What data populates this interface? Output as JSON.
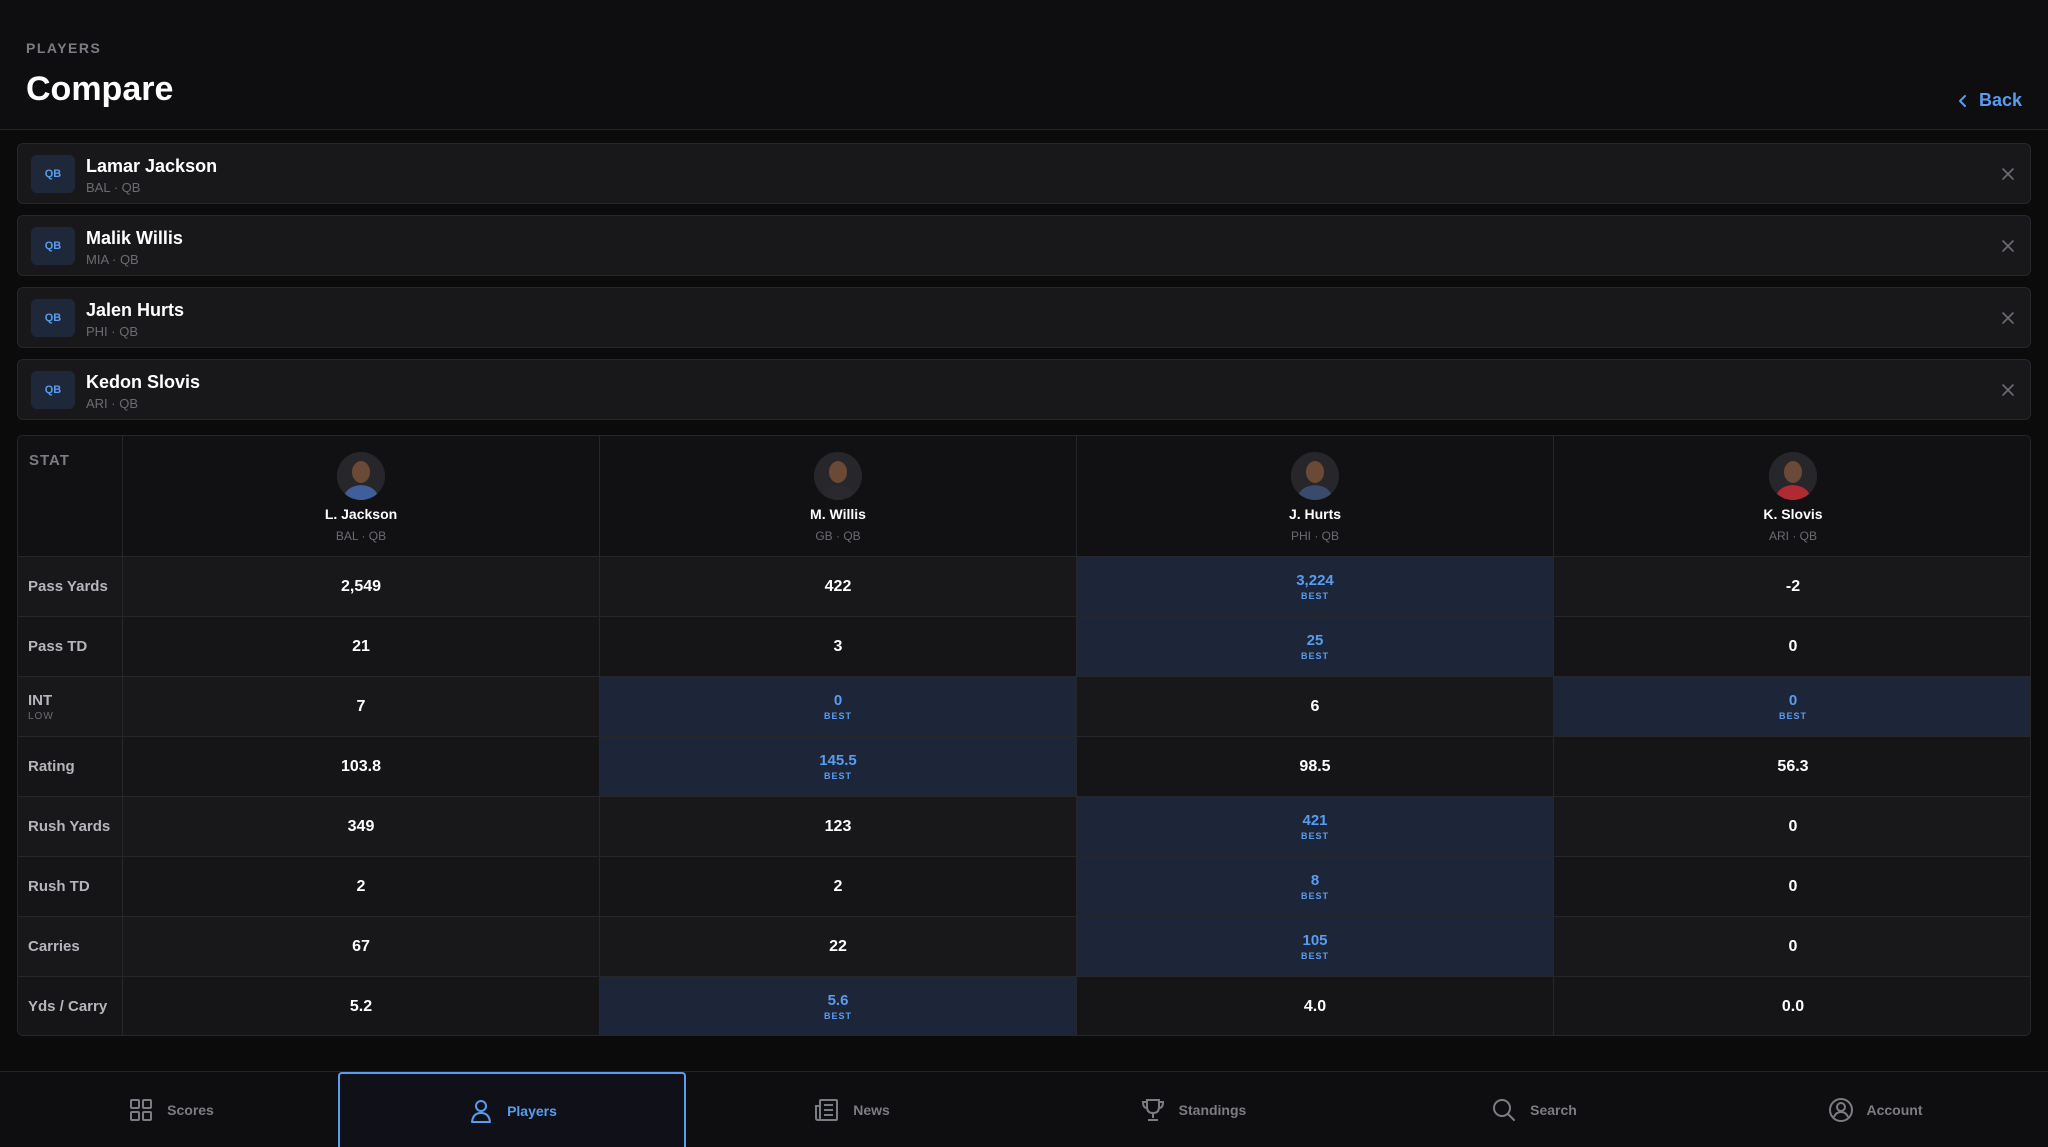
{
  "header": {
    "eyebrow": "PLAYERS",
    "title": "Compare",
    "back_label": "Back"
  },
  "players": [
    {
      "pos": "QB",
      "name": "Lamar Jackson",
      "sub": "BAL · QB"
    },
    {
      "pos": "QB",
      "name": "Malik Willis",
      "sub": "MIA · QB"
    },
    {
      "pos": "QB",
      "name": "Jalen Hurts",
      "sub": "PHI · QB"
    },
    {
      "pos": "QB",
      "name": "Kedon Slovis",
      "sub": "ARI · QB"
    }
  ],
  "table": {
    "stat_header": "STAT",
    "columns": [
      {
        "name": "L. Jackson",
        "sub": "BAL · QB",
        "jersey": "#3f5f9a"
      },
      {
        "name": "M. Willis",
        "sub": "GB · QB",
        "jersey": "#2a2a2e"
      },
      {
        "name": "J. Hurts",
        "sub": "PHI · QB",
        "jersey": "#3a4a6a"
      },
      {
        "name": "K. Slovis",
        "sub": "ARI · QB",
        "jersey": "#b02a33"
      }
    ],
    "best_label": "BEST",
    "rows": [
      {
        "label": "Pass Yards",
        "note": "",
        "values": [
          "2,549",
          "422",
          "3,224",
          "-2"
        ],
        "best": [
          false,
          false,
          true,
          false
        ]
      },
      {
        "label": "Pass TD",
        "note": "",
        "values": [
          "21",
          "3",
          "25",
          "0"
        ],
        "best": [
          false,
          false,
          true,
          false
        ]
      },
      {
        "label": "INT",
        "note": "LOW",
        "values": [
          "7",
          "0",
          "6",
          "0"
        ],
        "best": [
          false,
          true,
          false,
          true
        ]
      },
      {
        "label": "Rating",
        "note": "",
        "values": [
          "103.8",
          "145.5",
          "98.5",
          "56.3"
        ],
        "best": [
          false,
          true,
          false,
          false
        ]
      },
      {
        "label": "Rush Yards",
        "note": "",
        "values": [
          "349",
          "123",
          "421",
          "0"
        ],
        "best": [
          false,
          false,
          true,
          false
        ]
      },
      {
        "label": "Rush TD",
        "note": "",
        "values": [
          "2",
          "2",
          "8",
          "0"
        ],
        "best": [
          false,
          false,
          true,
          false
        ]
      },
      {
        "label": "Carries",
        "note": "",
        "values": [
          "67",
          "22",
          "105",
          "0"
        ],
        "best": [
          false,
          false,
          true,
          false
        ]
      },
      {
        "label": "Yds / Carry",
        "note": "",
        "values": [
          "5.2",
          "5.6",
          "4.0",
          "0.0"
        ],
        "best": [
          false,
          true,
          false,
          false
        ]
      }
    ]
  },
  "tabs": [
    {
      "label": "Scores",
      "icon": "grid-icon",
      "active": false
    },
    {
      "label": "Players",
      "icon": "person-icon",
      "active": true
    },
    {
      "label": "News",
      "icon": "newspaper-icon",
      "active": false
    },
    {
      "label": "Standings",
      "icon": "trophy-icon",
      "active": false
    },
    {
      "label": "Search",
      "icon": "search-icon",
      "active": false
    },
    {
      "label": "Account",
      "icon": "account-icon",
      "active": false
    }
  ],
  "colors": {
    "accent": "#5a9cf0",
    "best_bg": "#1c2638",
    "background": "#0b0b0c"
  }
}
